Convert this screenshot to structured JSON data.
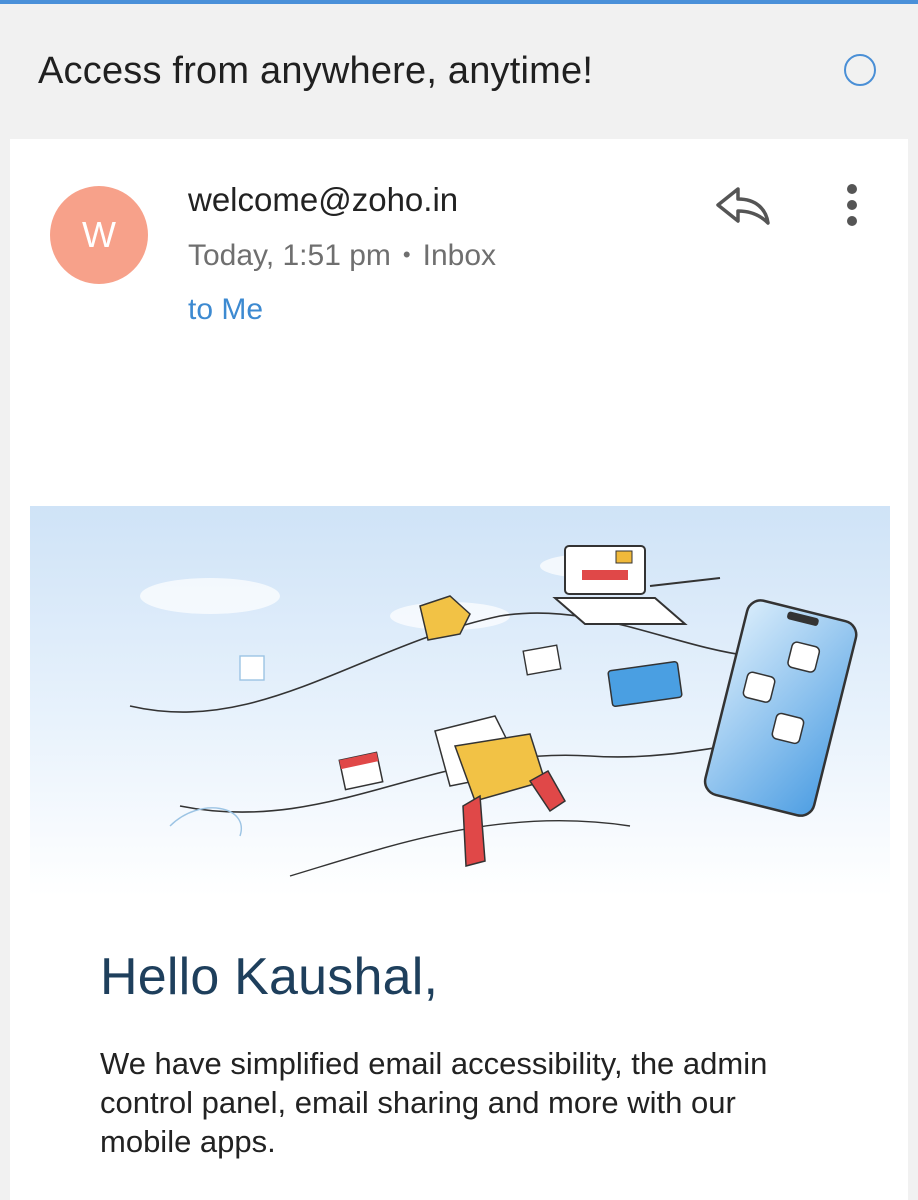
{
  "header": {
    "subject": "Access from anywhere, anytime!",
    "status_icon": "unread-circle-icon",
    "accent_color": "#4a8fd6"
  },
  "message": {
    "avatar_initial": "W",
    "avatar_color": "#f7a18a",
    "sender": "welcome@zoho.in",
    "date": "Today, 1:51 pm",
    "separator": "•",
    "folder": "Inbox",
    "recipient": "to Me",
    "actions": {
      "reply_icon": "reply-icon",
      "more_icon": "more-vertical-icon"
    }
  },
  "content": {
    "hero_illustration": "illustration of files, envelope and laptop flowing to a mobile phone",
    "greeting": "Hello Kaushal,",
    "paragraph": "We have simplified email accessibility, the admin control panel, email sharing and more with our mobile apps."
  }
}
